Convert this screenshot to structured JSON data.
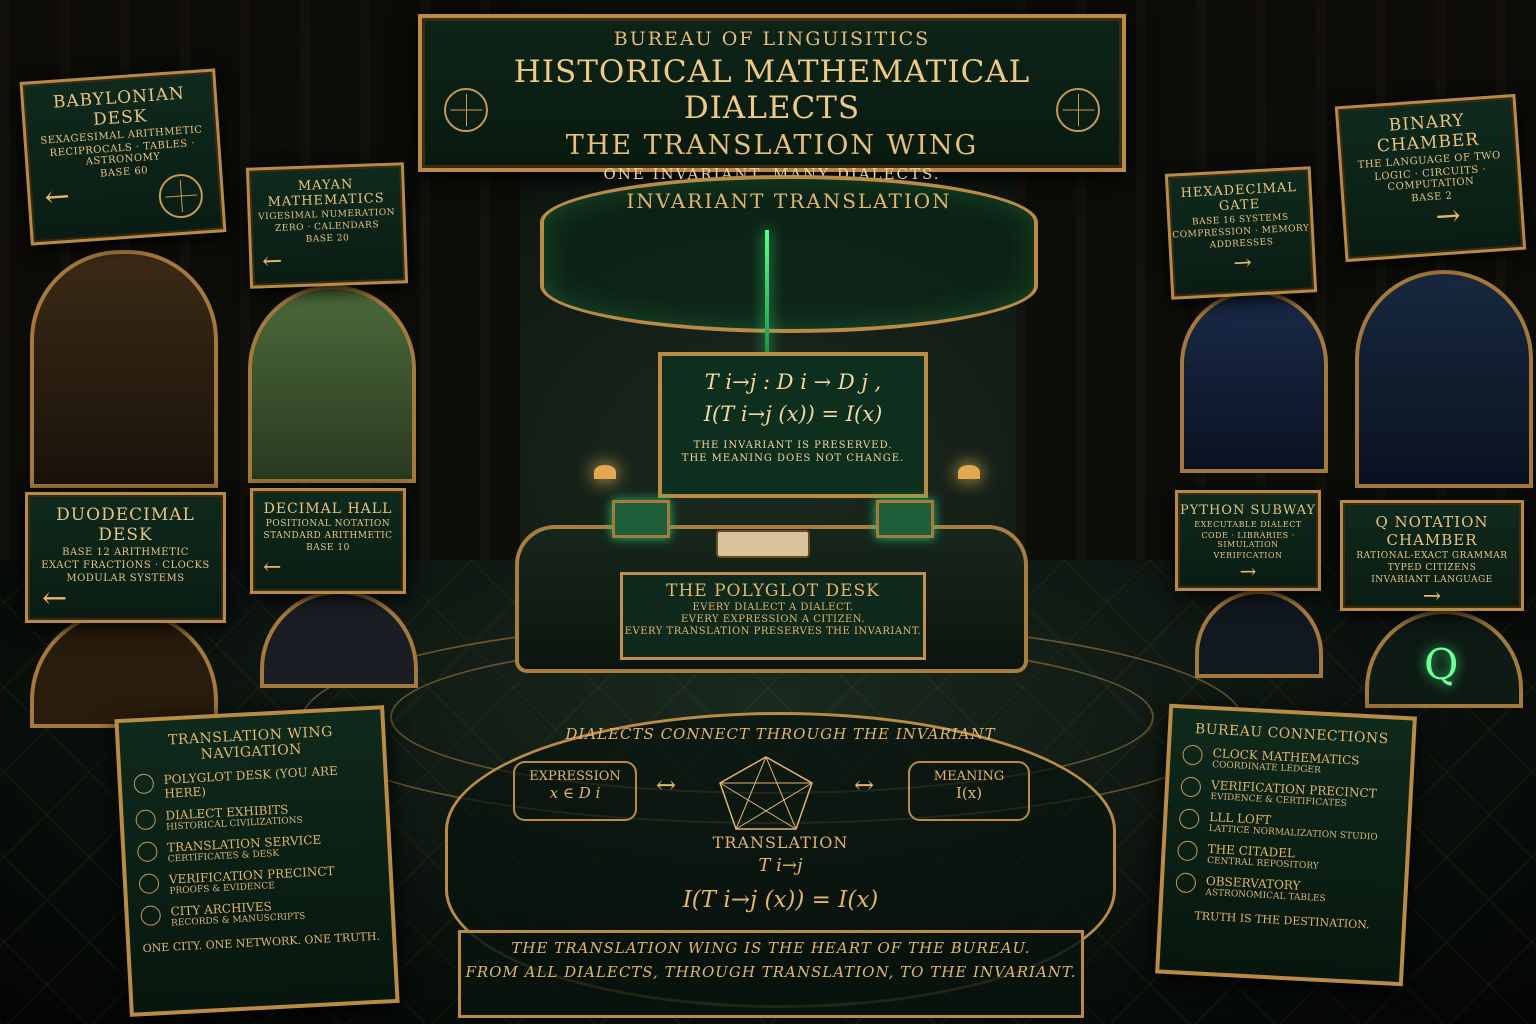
{
  "header": {
    "bureau": "BUREAU OF LINGUISITICS",
    "title": "HISTORICAL MATHEMATICAL DIALECTS",
    "wing": "THE TRANSLATION WING",
    "motto": "ONE INVARIANT. MANY DIALECTS."
  },
  "ring": {
    "title": "INVARIANT TRANSLATION"
  },
  "board": {
    "formula1": "T i→j : D i → D j ,",
    "formula2": "I(T i→j (x)) = I(x)",
    "note1": "THE INVARIANT IS PRESERVED.",
    "note2": "THE MEANING DOES NOT CHANGE."
  },
  "desk": {
    "title": "THE POLYGLOT DESK",
    "line1": "EVERY DIALECT A DIALECT.",
    "line2": "EVERY EXPRESSION A CITIZEN.",
    "line3": "EVERY TRANSLATION PRESERVES THE INVARIANT."
  },
  "left_signs": [
    {
      "title": "BABYLONIAN DESK",
      "lines": [
        "SEXAGESIMAL ARITHMETIC",
        "RECIPROCALS · TABLES · ASTRONOMY",
        "BASE 60"
      ]
    },
    {
      "title": "MAYAN MATHEMATICS",
      "lines": [
        "VIGESIMAL NUMERATION",
        "ZERO · CALENDARS",
        "BASE 20"
      ]
    },
    {
      "title": "DUODECIMAL DESK",
      "lines": [
        "BASE 12 ARITHMETIC",
        "EXACT FRACTIONS · CLOCKS",
        "MODULAR SYSTEMS"
      ]
    },
    {
      "title": "DECIMAL HALL",
      "lines": [
        "POSITIONAL NOTATION",
        "STANDARD ARITHMETIC",
        "BASE 10"
      ]
    }
  ],
  "right_signs": [
    {
      "title": "BINARY CHAMBER",
      "lines": [
        "THE LANGUAGE OF TWO",
        "LOGIC · CIRCUITS · COMPUTATION",
        "BASE 2"
      ]
    },
    {
      "title": "HEXADECIMAL GATE",
      "lines": [
        "BASE 16 SYSTEMS",
        "COMPRESSION · MEMORY",
        "ADDRESSES"
      ]
    },
    {
      "title": "PYTHON SUBWAY",
      "lines": [
        "EXECUTABLE DIALECT",
        "CODE · LIBRARIES · SIMULATION",
        "VERIFICATION"
      ]
    },
    {
      "title": "Q NOTATION CHAMBER",
      "lines": [
        "RATIONAL-EXACT GRAMMAR",
        "TYPED CITIZENS",
        "INVARIANT LANGUAGE"
      ]
    }
  ],
  "arrows": {
    "left": "←",
    "right": "→"
  },
  "medallion": {
    "title": "DIALECTS CONNECT THROUGH THE INVARIANT",
    "expression_label": "EXPRESSION",
    "expression_math": "x ∈ D i",
    "meaning_label": "MEANING",
    "meaning_math": "I(x)",
    "translation_label": "TRANSLATION",
    "translation_math": "T i→j",
    "equation": "I(T i→j (x)) = I(x)",
    "arrow_lr": "↔"
  },
  "footer": {
    "line1": "THE TRANSLATION WING IS THE HEART OF THE BUREAU.",
    "line2": "FROM ALL DIALECTS, THROUGH TRANSLATION, TO THE INVARIANT."
  },
  "nav_left": {
    "title": "TRANSLATION WING NAVIGATION",
    "items": [
      {
        "main": "POLYGLOT DESK (YOU ARE HERE)",
        "sub": ""
      },
      {
        "main": "DIALECT EXHIBITS",
        "sub": "HISTORICAL CIVILIZATIONS"
      },
      {
        "main": "TRANSLATION SERVICE",
        "sub": "CERTIFICATES & DESK"
      },
      {
        "main": "VERIFICATION PRECINCT",
        "sub": "PROOFS & EVIDENCE"
      },
      {
        "main": "CITY ARCHIVES",
        "sub": "RECORDS & MANUSCRIPTS"
      }
    ],
    "footer": "ONE CITY. ONE NETWORK. ONE TRUTH."
  },
  "nav_right": {
    "title": "BUREAU CONNECTIONS",
    "items": [
      {
        "main": "CLOCK MATHEMATICS",
        "sub": "COORDINATE LEDGER"
      },
      {
        "main": "VERIFICATION PRECINCT",
        "sub": "EVIDENCE & CERTIFICATES"
      },
      {
        "main": "LLL LOFT",
        "sub": "LATTICE NORMALIZATION STUDIO"
      },
      {
        "main": "THE CITADEL",
        "sub": "CENTRAL REPOSITORY"
      },
      {
        "main": "OBSERVATORY",
        "sub": "ASTRONOMICAL TABLES"
      }
    ],
    "footer": "TRUTH IS THE DESTINATION."
  },
  "q_glyph": "Q",
  "colors": {
    "gold": "#e2b56b",
    "green": "#0f2a1c",
    "glow": "#3fe07a"
  }
}
